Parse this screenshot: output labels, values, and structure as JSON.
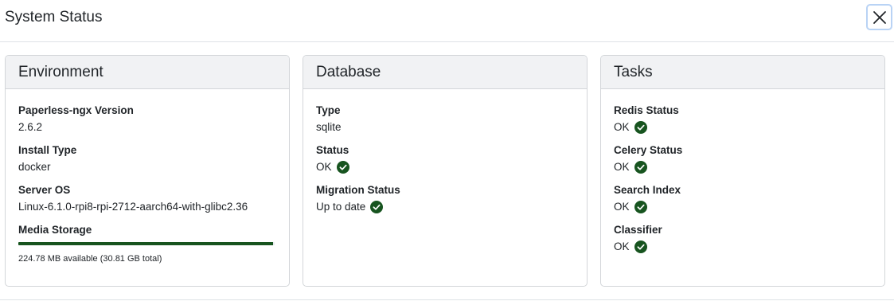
{
  "modal": {
    "title": "System Status",
    "close_icon": "close-icon"
  },
  "colors": {
    "ok_green": "#17541f",
    "progress_fill": "#17541f",
    "card_header_bg": "#f1f2f4"
  },
  "environment": {
    "title": "Environment",
    "version_label": "Paperless-ngx Version",
    "version_value": "2.6.2",
    "install_type_label": "Install Type",
    "install_type_value": "docker",
    "server_os_label": "Server OS",
    "server_os_value": "Linux-6.1.0-rpi8-rpi-2712-aarch64-with-glibc2.36",
    "media_storage_label": "Media Storage",
    "media_storage_used_fraction": 0.993,
    "media_storage_text": "224.78 MB available (30.81 GB total)"
  },
  "database": {
    "title": "Database",
    "type_label": "Type",
    "type_value": "sqlite",
    "status_label": "Status",
    "status_value": "OK",
    "migration_label": "Migration Status",
    "migration_value": "Up to date"
  },
  "tasks": {
    "title": "Tasks",
    "redis_label": "Redis Status",
    "redis_value": "OK",
    "celery_label": "Celery Status",
    "celery_value": "OK",
    "search_label": "Search Index",
    "search_value": "OK",
    "classifier_label": "Classifier",
    "classifier_value": "OK"
  }
}
